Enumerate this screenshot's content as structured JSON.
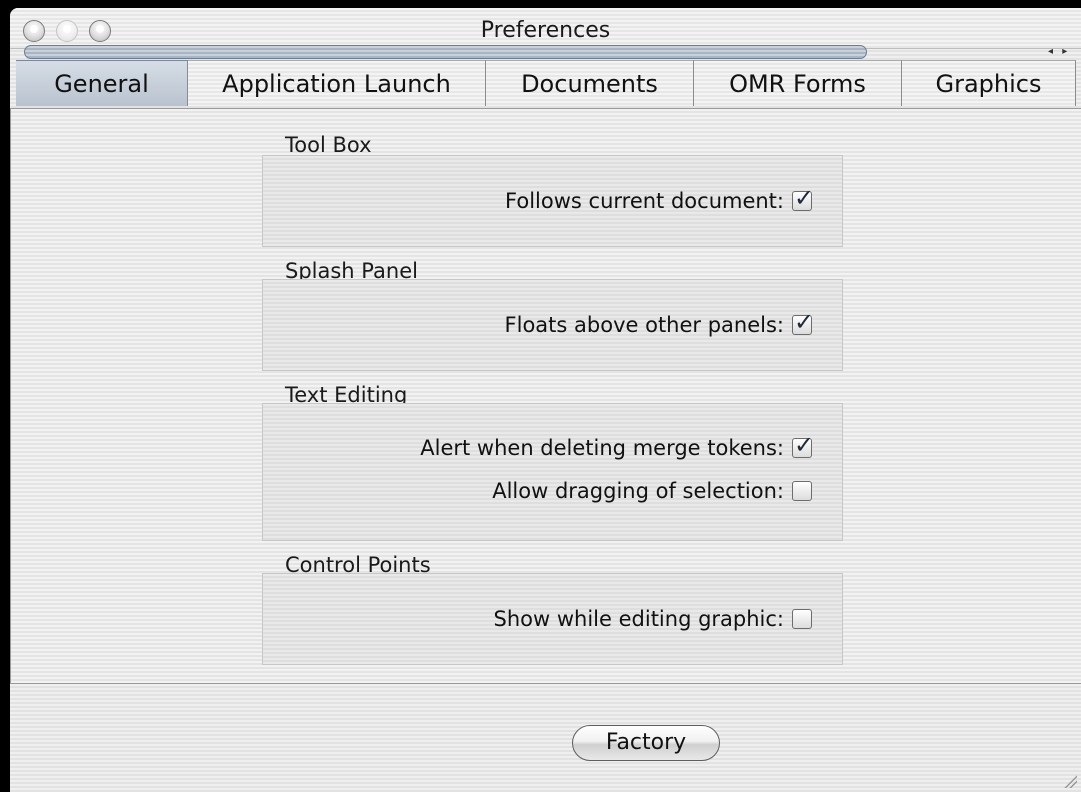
{
  "window": {
    "title": "Preferences"
  },
  "tabs": [
    {
      "label": "General",
      "active": true
    },
    {
      "label": "Application Launch",
      "active": false
    },
    {
      "label": "Documents",
      "active": false
    },
    {
      "label": "OMR Forms",
      "active": false
    },
    {
      "label": "Graphics",
      "active": false
    }
  ],
  "scroll_arrows": "◂ ▸",
  "groups": {
    "tool_box": {
      "title": "Tool Box",
      "options": [
        {
          "label": "Follows current document:",
          "checked": true
        }
      ]
    },
    "splash_panel": {
      "title": "Splash Panel",
      "options": [
        {
          "label": "Floats above other panels:",
          "checked": true
        }
      ]
    },
    "text_editing": {
      "title": "Text Editing",
      "options": [
        {
          "label": "Alert when deleting merge tokens:",
          "checked": true
        },
        {
          "label": "Allow dragging of selection:",
          "checked": false
        }
      ]
    },
    "control_points": {
      "title": "Control Points",
      "options": [
        {
          "label": "Show while editing graphic:",
          "checked": false
        }
      ]
    }
  },
  "check_glyph": "✓",
  "factory_label": "Factory",
  "icons": {
    "close": "close-icon",
    "minimize": "minimize-icon",
    "zoom": "zoom-icon",
    "resize": "resize-grip-icon"
  },
  "colors": {
    "active_tab": "#c3ccd7",
    "checkmark": "#1f2a3b"
  }
}
